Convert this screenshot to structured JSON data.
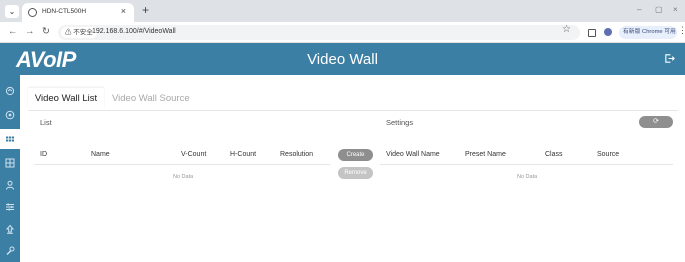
{
  "browser": {
    "tab_title": "HDN-CTL500H",
    "tab_close": "×",
    "new_tab": "+",
    "insecure_label": "⚠ 不安全",
    "url": "192.168.6.100/#/VideoWall",
    "update_label": "有新版 Chrome 可用",
    "window_controls": [
      "–",
      "▢",
      "×"
    ]
  },
  "header": {
    "logo": "AVoIP",
    "title": "Video Wall"
  },
  "sidebar": {
    "items": [
      {
        "icon": "layers-icon",
        "active": false
      },
      {
        "icon": "target-icon",
        "active": false
      },
      {
        "icon": "video-wall-icon",
        "active": true
      },
      {
        "icon": "grid-icon",
        "active": false
      },
      {
        "icon": "user-icon",
        "active": false
      },
      {
        "icon": "sliders-icon",
        "active": false
      },
      {
        "icon": "upload-icon",
        "active": false
      },
      {
        "icon": "wrench-icon",
        "active": false
      }
    ]
  },
  "tabs": [
    {
      "label": "Video Wall List",
      "active": true
    },
    {
      "label": "Video Wall Source",
      "active": false
    }
  ],
  "list": {
    "label": "List",
    "columns": [
      "ID",
      "Name",
      "V-Count",
      "H-Count",
      "Resolution"
    ],
    "empty_text": "No Data"
  },
  "actions": {
    "create_label": "Create",
    "remove_label": "Remove"
  },
  "settings": {
    "label": "Settings",
    "refresh_label": "⟳",
    "columns": [
      "Video Wall Name",
      "Preset Name",
      "Class",
      "Source"
    ],
    "empty_text": "No Data"
  },
  "colors": {
    "brand": "#3b7fa5",
    "button": "#8e8e8e",
    "button_disabled": "#c4c4c4"
  }
}
